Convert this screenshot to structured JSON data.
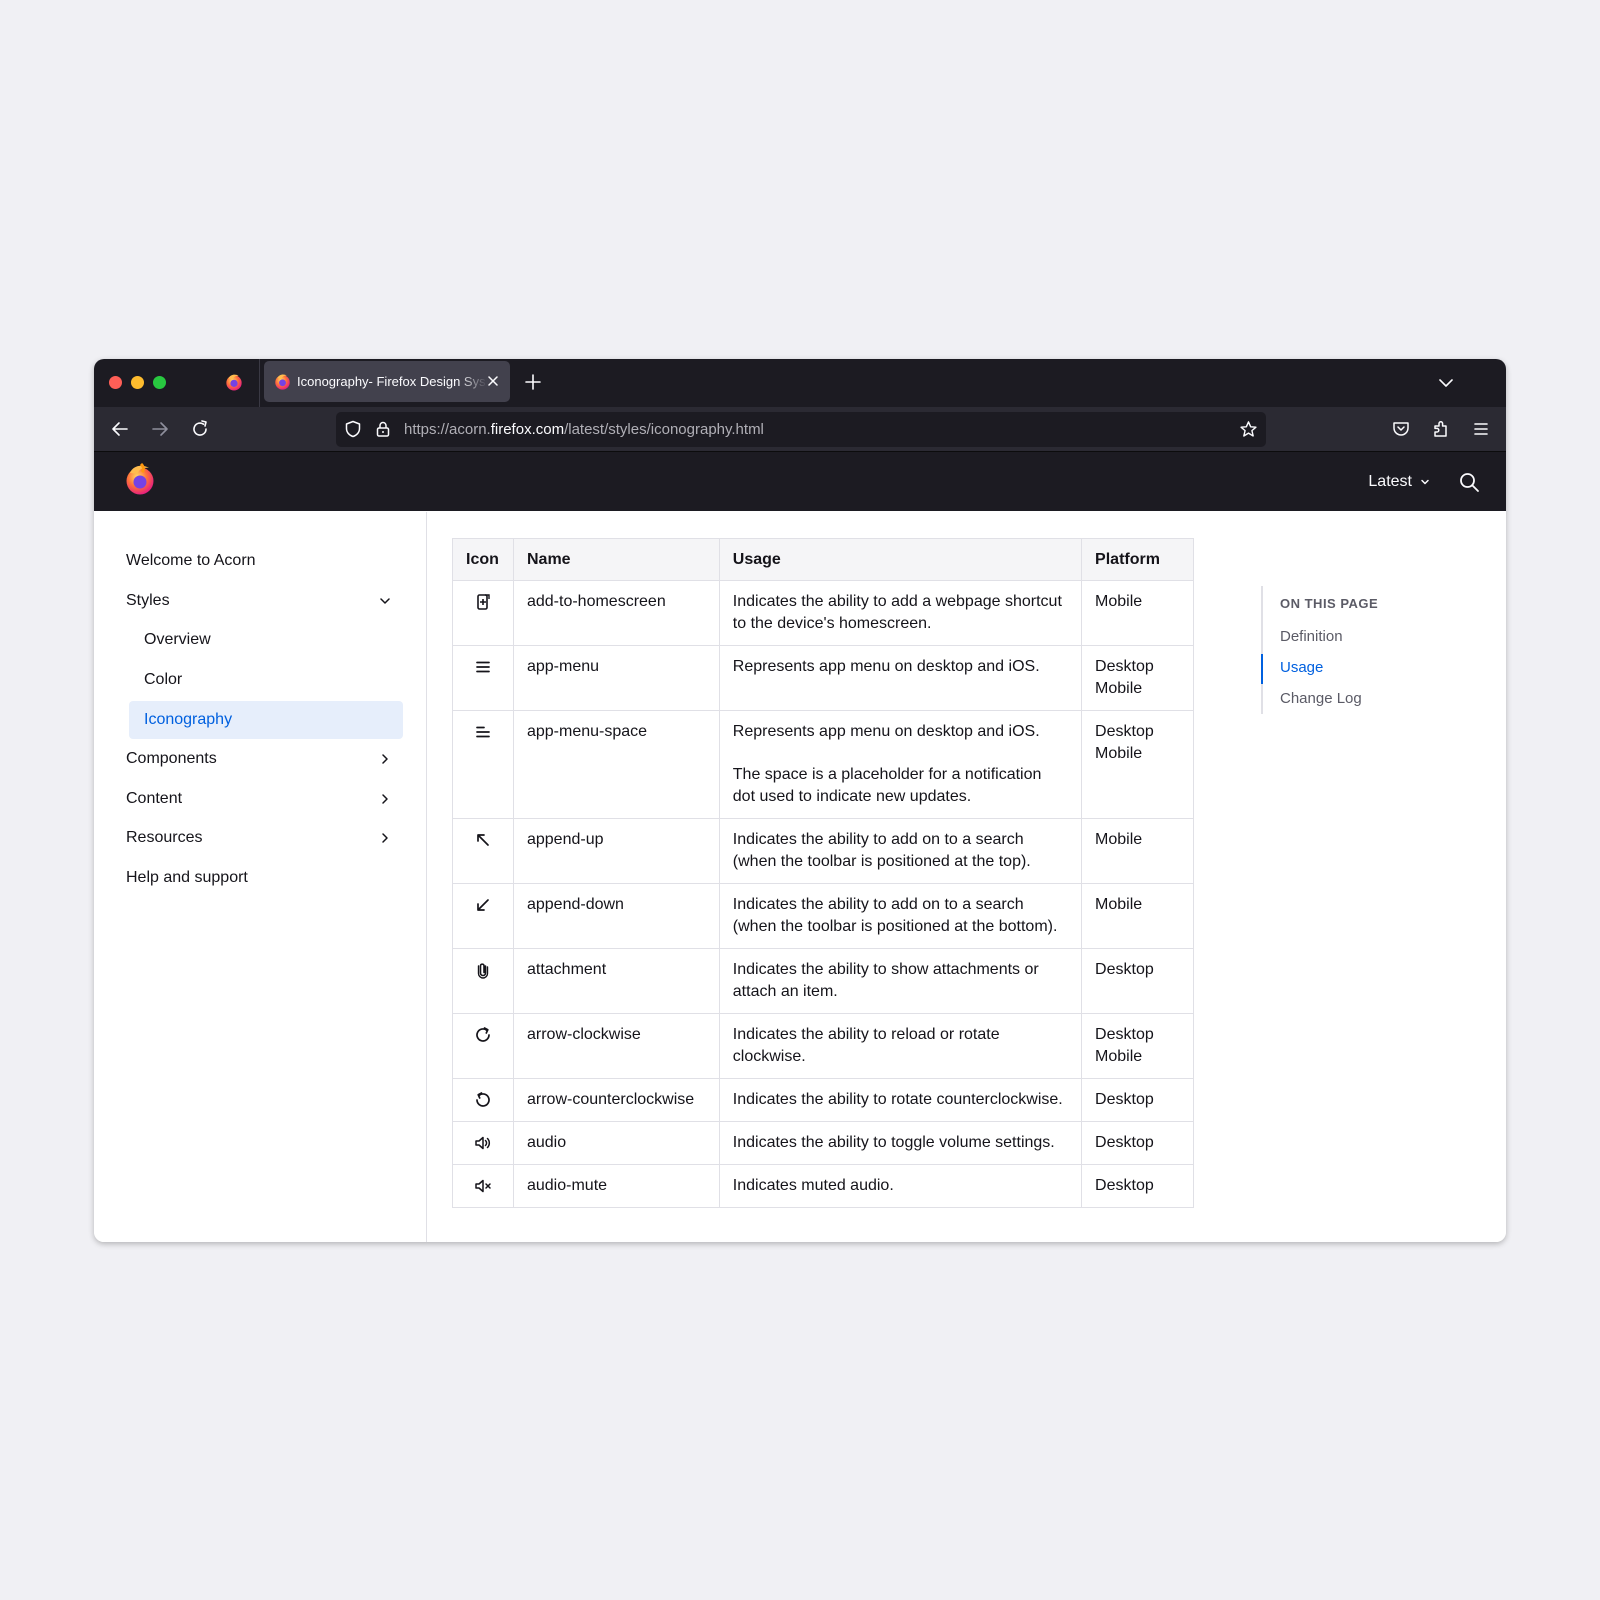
{
  "browser": {
    "tab_title": "Iconography- Firefox Design System",
    "url_prefix": "https://acorn.",
    "url_host": "firefox.com",
    "url_path": "/latest/styles/iconography.html"
  },
  "site_header": {
    "version_label": "Latest"
  },
  "sidebar": {
    "items": [
      {
        "label": "Welcome to Acorn"
      },
      {
        "label": "Styles"
      },
      {
        "label": "Overview"
      },
      {
        "label": "Color"
      },
      {
        "label": "Iconography"
      },
      {
        "label": "Components"
      },
      {
        "label": "Content"
      },
      {
        "label": "Resources"
      },
      {
        "label": "Help and support"
      }
    ]
  },
  "table": {
    "headers": [
      "Icon",
      "Name",
      "Usage",
      "Platform"
    ],
    "rows": [
      {
        "icon": "add-to-homescreen-icon",
        "name": "add-to-homescreen",
        "usage": [
          "Indicates the ability to add a webpage shortcut to the device's homescreen."
        ],
        "platform": [
          "Mobile"
        ]
      },
      {
        "icon": "app-menu-icon",
        "name": "app-menu",
        "usage": [
          "Represents app menu on desktop and iOS."
        ],
        "platform": [
          "Desktop",
          "Mobile"
        ]
      },
      {
        "icon": "app-menu-space-icon",
        "name": "app-menu-space",
        "usage": [
          "Represents app menu on desktop and iOS.",
          "The space is a placeholder for a notification dot used to indicate new updates."
        ],
        "platform": [
          "Desktop",
          "Mobile"
        ]
      },
      {
        "icon": "append-up-icon",
        "name": "append-up",
        "usage": [
          "Indicates the ability to add on to a search (when the toolbar is positioned at the top)."
        ],
        "platform": [
          "Mobile"
        ]
      },
      {
        "icon": "append-down-icon",
        "name": "append-down",
        "usage": [
          "Indicates the ability to add on to a search (when the toolbar is positioned at the bottom)."
        ],
        "platform": [
          "Mobile"
        ]
      },
      {
        "icon": "attachment-icon",
        "name": "attachment",
        "usage": [
          "Indicates the ability to show attachments or attach an item."
        ],
        "platform": [
          "Desktop"
        ]
      },
      {
        "icon": "arrow-clockwise-icon",
        "name": "arrow-clockwise",
        "usage": [
          "Indicates the ability to reload or rotate clockwise."
        ],
        "platform": [
          "Desktop",
          "Mobile"
        ]
      },
      {
        "icon": "arrow-counterclockwise-icon",
        "name": "arrow-counterclockwise",
        "usage": [
          "Indicates the ability to rotate counterclockwise."
        ],
        "platform": [
          "Desktop"
        ]
      },
      {
        "icon": "audio-icon",
        "name": "audio",
        "usage": [
          "Indicates the ability to toggle volume settings."
        ],
        "platform": [
          "Desktop"
        ]
      },
      {
        "icon": "audio-mute-icon",
        "name": "audio-mute",
        "usage": [
          "Indicates muted audio."
        ],
        "platform": [
          "Desktop"
        ]
      }
    ]
  },
  "toc": {
    "heading": "ON THIS PAGE",
    "items": [
      {
        "label": "Definition"
      },
      {
        "label": "Usage"
      },
      {
        "label": "Change Log"
      }
    ]
  },
  "colors": {
    "accent": "#0060df",
    "active_bg": "#e6eefb",
    "chrome_dark": "#1c1b22",
    "page_bg": "#f0f0f4"
  }
}
